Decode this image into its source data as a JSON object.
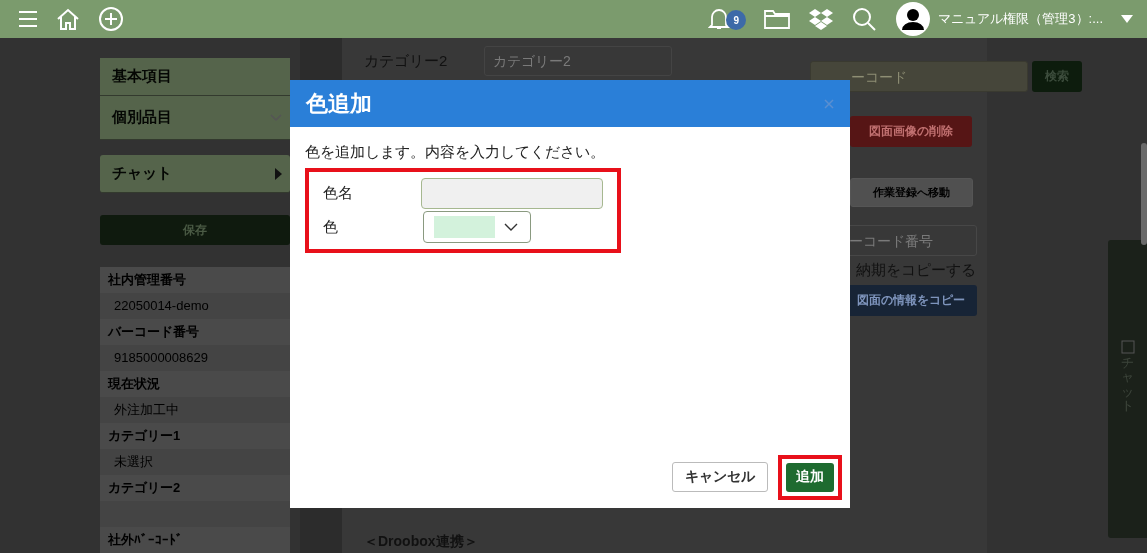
{
  "top_bar": {
    "notification_count": "9",
    "user_name": "マニュアル権限（管理3）:..."
  },
  "sidebar": {
    "nav_items": [
      {
        "label": "基本項目",
        "kind": "plain"
      },
      {
        "label": "個別品目",
        "kind": "expandable"
      },
      {
        "label": "チャット",
        "kind": "submenu"
      }
    ],
    "save_button": "保存",
    "fields": [
      {
        "label": "社内管理番号",
        "value": "22050014-demo"
      },
      {
        "label": "バーコード番号",
        "value": "9185000008629"
      },
      {
        "label": "現在状況",
        "value": "外注加工中"
      },
      {
        "label": "カテゴリー1",
        "value": "未選択"
      },
      {
        "label": "カテゴリー2"
      },
      {
        "label": "社外ﾊﾞｰｺｰﾄﾞ"
      }
    ]
  },
  "content": {
    "category2_label": "カテゴリー2",
    "category2_placeholder": "カテゴリー2",
    "dropbox_heading": "＜Droobox連携＞"
  },
  "right_panel": {
    "search_placeholder": "ーコード",
    "search_button": "検索",
    "delete_button": "図面画像の削除",
    "move_button": "作業登録へ移動",
    "barcode_placeholder": "ーコード番号",
    "copy_due_text": "納期をコピーする",
    "copy_drawing_button": "図面の情報をコピー",
    "chat_tab": "チャット"
  },
  "dialog": {
    "title": "色追加",
    "message": "色を追加します。内容を入力してください。",
    "form_highlighted": true,
    "fields": [
      {
        "label": "色名",
        "kind": "text"
      },
      {
        "label": "色",
        "kind": "color",
        "color": "#d3f2dc"
      }
    ],
    "buttons": [
      {
        "label": "キャンセル",
        "kind": "secondary",
        "highlighted": false
      },
      {
        "label": "追加",
        "kind": "primary",
        "highlighted": true
      }
    ]
  }
}
